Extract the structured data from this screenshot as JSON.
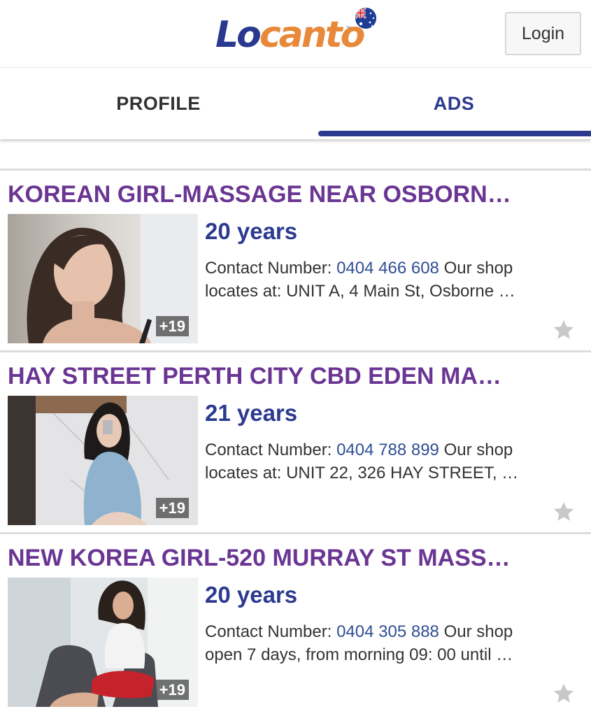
{
  "header": {
    "logo_lo": "Lo",
    "logo_canto": "canto",
    "logo_tm": "™",
    "flag_icon": "australia-flag-icon",
    "login_label": "Login"
  },
  "tabs": [
    {
      "label": "PROFILE",
      "active": false
    },
    {
      "label": "ADS",
      "active": true
    }
  ],
  "colors": {
    "brand_blue": "#2c3a8f",
    "brand_orange": "#e8893a",
    "title_purple": "#6a3593",
    "phone_blue": "#2f4f93"
  },
  "listings": [
    {
      "title": "KOREAN GIRL-MASSAGE NEAR OSBORN…",
      "age": "20 years",
      "contact_label": "Contact Number:",
      "phone": "0404 466 608",
      "desc_rest": "Our shop",
      "desc_line2": "locates at: UNIT A, 4 Main St, Osborne …",
      "photo_count": "+19"
    },
    {
      "title": "HAY STREET PERTH CITY CBD EDEN MA…",
      "age": "21 years",
      "contact_label": "Contact Number:",
      "phone": "0404 788 899",
      "desc_rest": "Our shop",
      "desc_line2": "locates at: UNIT 22, 326 HAY STREET, …",
      "photo_count": "+19"
    },
    {
      "title": "NEW KOREA GIRL-520 MURRAY ST MASS…",
      "age": "20 years",
      "contact_label": "Contact Number:",
      "phone": "0404 305 888",
      "desc_rest": "Our shop",
      "desc_line2": "open 7 days, from morning 09: 00 until …",
      "photo_count": "+19"
    }
  ]
}
